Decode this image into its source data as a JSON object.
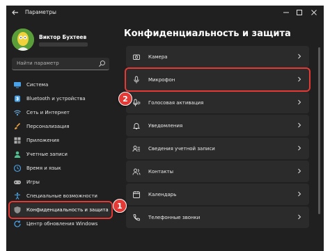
{
  "app": {
    "title": "Параметры"
  },
  "profile": {
    "name": "Виктор Бухтеев"
  },
  "search": {
    "placeholder": "Найти параметр"
  },
  "sidebar": {
    "items": [
      {
        "label": "Система",
        "icon": "monitor-icon",
        "color": "#4aa3e8"
      },
      {
        "label": "Bluetooth и устройства",
        "icon": "bluetooth-icon",
        "color": "#4aa3e8"
      },
      {
        "label": "Сеть и Интернет",
        "icon": "wifi-icon",
        "color": "#6ab0e8"
      },
      {
        "label": "Персонализация",
        "icon": "paintbrush-icon",
        "color": "#e8a040"
      },
      {
        "label": "Приложения",
        "icon": "apps-icon",
        "color": "#b0b0b0"
      },
      {
        "label": "Учетные записи",
        "icon": "person-icon",
        "color": "#50c090"
      },
      {
        "label": "Время и язык",
        "icon": "globe-clock-icon",
        "color": "#4aa3e8"
      },
      {
        "label": "Игры",
        "icon": "gamepad-icon",
        "color": "#b0b0b0"
      },
      {
        "label": "Специальные возможности",
        "icon": "accessibility-icon",
        "color": "#4aa3e8"
      },
      {
        "label": "Конфиденциальность и защита",
        "icon": "shield-icon",
        "color": "#909090"
      },
      {
        "label": "Центр обновления Windows",
        "icon": "update-icon",
        "color": "#4aa3e8"
      }
    ]
  },
  "main": {
    "title": "Конфиденциальность и защита",
    "rows": [
      {
        "label": "Камера",
        "icon": "camera-icon"
      },
      {
        "label": "Микрофон",
        "icon": "microphone-icon"
      },
      {
        "label": "Голосовая активация",
        "icon": "voice-activation-icon"
      },
      {
        "label": "Уведомления",
        "icon": "bell-icon"
      },
      {
        "label": "Сведения учетной записи",
        "icon": "account-info-icon"
      },
      {
        "label": "Контакты",
        "icon": "contacts-icon"
      },
      {
        "label": "Календарь",
        "icon": "calendar-icon"
      },
      {
        "label": "Телефонные звонки",
        "icon": "phone-icon"
      }
    ]
  },
  "annotations": {
    "badge1": "1",
    "badge2": "2",
    "accent": "#e53935"
  }
}
